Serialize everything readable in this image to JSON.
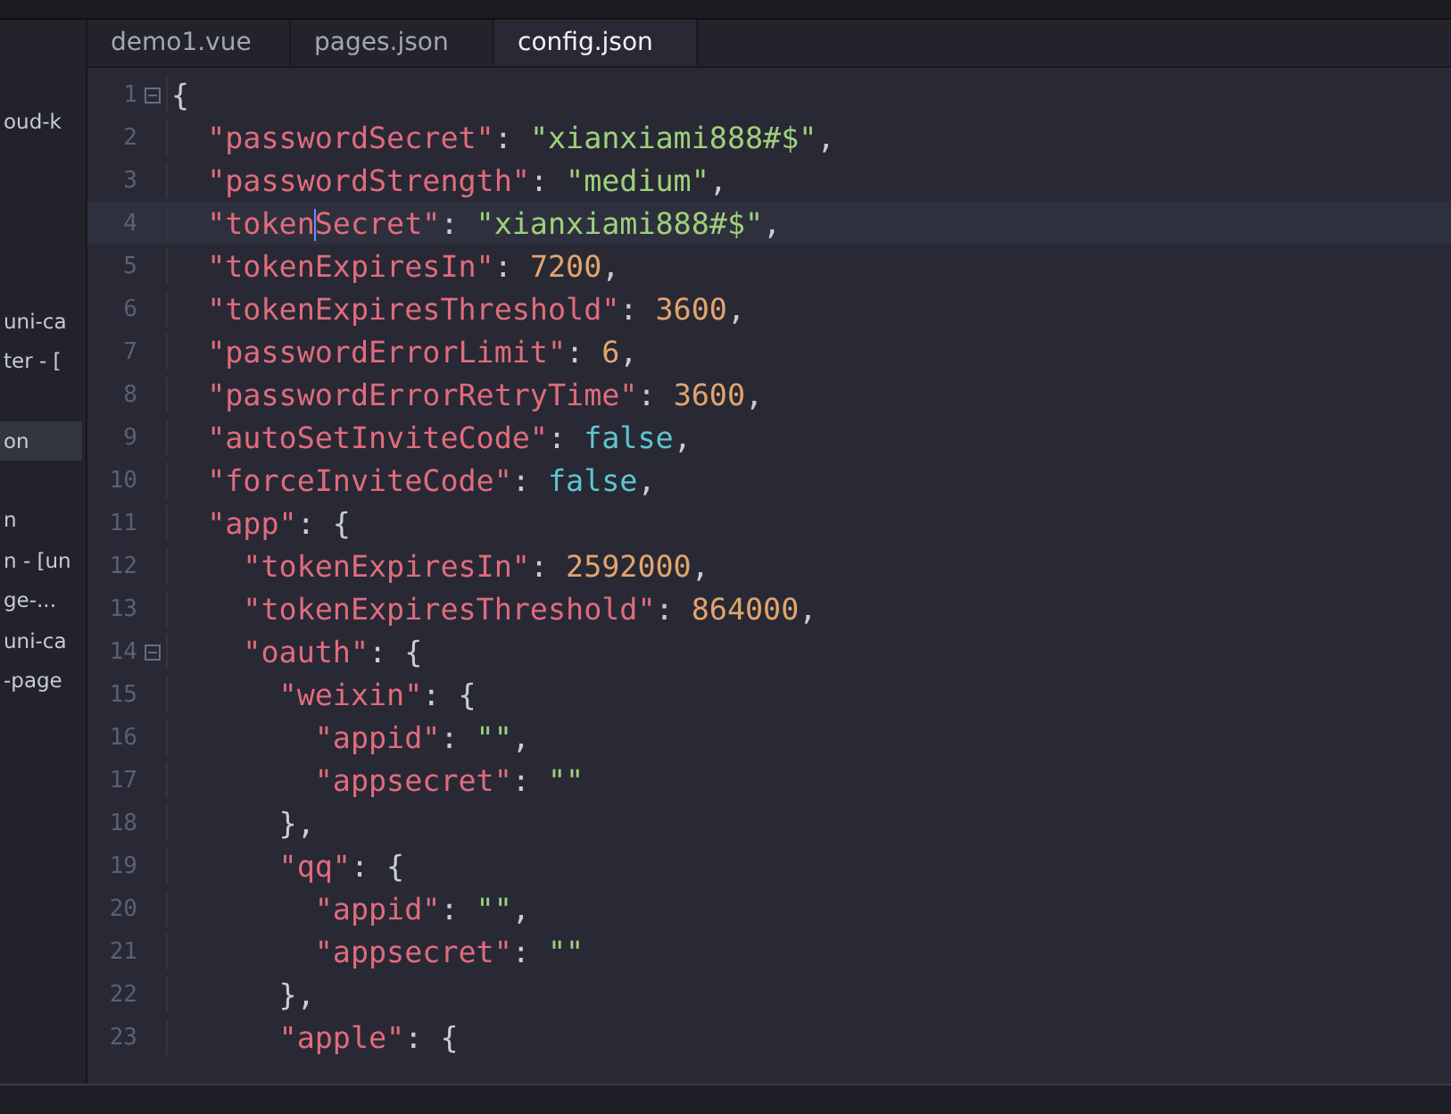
{
  "sidebar": {
    "groups": [
      [
        "oud-k"
      ],
      [
        "uni-ca",
        "ter - ["
      ],
      [
        {
          "label": "on",
          "selected": true
        }
      ],
      [
        "n",
        "n - [un",
        "ge-...",
        "uni-ca",
        "-page"
      ]
    ]
  },
  "tabs": [
    {
      "label": "demo1.vue",
      "selected": false
    },
    {
      "label": "pages.json",
      "selected": false
    },
    {
      "label": "config.json",
      "selected": true
    }
  ],
  "editor": {
    "lines": [
      {
        "number": "1",
        "foldable": true,
        "current": false,
        "tokens": [
          {
            "kind": "punct",
            "text": "{"
          }
        ]
      },
      {
        "number": "2",
        "foldable": false,
        "current": false,
        "tokens": [
          {
            "kind": "key",
            "text": "  \"passwordSecret\""
          },
          {
            "kind": "punct",
            "text": ": "
          },
          {
            "kind": "str",
            "text": "\"xianxiami888#$\""
          },
          {
            "kind": "punct",
            "text": ","
          }
        ]
      },
      {
        "number": "3",
        "foldable": false,
        "current": false,
        "tokens": [
          {
            "kind": "key",
            "text": "  \"passwordStrength\""
          },
          {
            "kind": "punct",
            "text": ": "
          },
          {
            "kind": "str",
            "text": "\"medium\""
          },
          {
            "kind": "punct",
            "text": ","
          }
        ]
      },
      {
        "number": "4",
        "foldable": false,
        "current": true,
        "tokens": [
          {
            "kind": "key",
            "text": "  \"token",
            "cursor": true
          },
          {
            "kind": "key",
            "text": "Secret\""
          },
          {
            "kind": "punct",
            "text": ": "
          },
          {
            "kind": "str",
            "text": "\"xianxiami888#$\""
          },
          {
            "kind": "punct",
            "text": ","
          }
        ]
      },
      {
        "number": "5",
        "foldable": false,
        "current": false,
        "tokens": [
          {
            "kind": "key",
            "text": "  \"tokenExpiresIn\""
          },
          {
            "kind": "punct",
            "text": ": "
          },
          {
            "kind": "num",
            "text": "7200"
          },
          {
            "kind": "punct",
            "text": ","
          }
        ]
      },
      {
        "number": "6",
        "foldable": false,
        "current": false,
        "tokens": [
          {
            "kind": "key",
            "text": "  \"tokenExpiresThreshold\""
          },
          {
            "kind": "punct",
            "text": ": "
          },
          {
            "kind": "num",
            "text": "3600"
          },
          {
            "kind": "punct",
            "text": ","
          }
        ]
      },
      {
        "number": "7",
        "foldable": false,
        "current": false,
        "tokens": [
          {
            "kind": "key",
            "text": "  \"passwordErrorLimit\""
          },
          {
            "kind": "punct",
            "text": ": "
          },
          {
            "kind": "num",
            "text": "6"
          },
          {
            "kind": "punct",
            "text": ","
          }
        ]
      },
      {
        "number": "8",
        "foldable": false,
        "current": false,
        "tokens": [
          {
            "kind": "key",
            "text": "  \"passwordErrorRetryTime\""
          },
          {
            "kind": "punct",
            "text": ": "
          },
          {
            "kind": "num",
            "text": "3600"
          },
          {
            "kind": "punct",
            "text": ","
          }
        ]
      },
      {
        "number": "9",
        "foldable": false,
        "current": false,
        "tokens": [
          {
            "kind": "key",
            "text": "  \"autoSetInviteCode\""
          },
          {
            "kind": "punct",
            "text": ": "
          },
          {
            "kind": "bool",
            "text": "false"
          },
          {
            "kind": "punct",
            "text": ","
          }
        ]
      },
      {
        "number": "10",
        "foldable": false,
        "current": false,
        "tokens": [
          {
            "kind": "key",
            "text": "  \"forceInviteCode\""
          },
          {
            "kind": "punct",
            "text": ": "
          },
          {
            "kind": "bool",
            "text": "false"
          },
          {
            "kind": "punct",
            "text": ","
          }
        ]
      },
      {
        "number": "11",
        "foldable": false,
        "current": false,
        "tokens": [
          {
            "kind": "key",
            "text": "  \"app\""
          },
          {
            "kind": "punct",
            "text": ": {"
          }
        ]
      },
      {
        "number": "12",
        "foldable": false,
        "current": false,
        "tokens": [
          {
            "kind": "key",
            "text": "    \"tokenExpiresIn\""
          },
          {
            "kind": "punct",
            "text": ": "
          },
          {
            "kind": "num",
            "text": "2592000"
          },
          {
            "kind": "punct",
            "text": ","
          }
        ]
      },
      {
        "number": "13",
        "foldable": false,
        "current": false,
        "tokens": [
          {
            "kind": "key",
            "text": "    \"tokenExpiresThreshold\""
          },
          {
            "kind": "punct",
            "text": ": "
          },
          {
            "kind": "num",
            "text": "864000"
          },
          {
            "kind": "punct",
            "text": ","
          }
        ]
      },
      {
        "number": "14",
        "foldable": true,
        "current": false,
        "tokens": [
          {
            "kind": "key",
            "text": "    \"oauth\""
          },
          {
            "kind": "punct",
            "text": ": {"
          }
        ]
      },
      {
        "number": "15",
        "foldable": false,
        "current": false,
        "tokens": [
          {
            "kind": "key",
            "text": "      \"weixin\""
          },
          {
            "kind": "punct",
            "text": ": {"
          }
        ]
      },
      {
        "number": "16",
        "foldable": false,
        "current": false,
        "tokens": [
          {
            "kind": "key",
            "text": "        \"appid\""
          },
          {
            "kind": "punct",
            "text": ": "
          },
          {
            "kind": "str",
            "text": "\"\""
          },
          {
            "kind": "punct",
            "text": ","
          }
        ]
      },
      {
        "number": "17",
        "foldable": false,
        "current": false,
        "tokens": [
          {
            "kind": "key",
            "text": "        \"appsecret\""
          },
          {
            "kind": "punct",
            "text": ": "
          },
          {
            "kind": "str",
            "text": "\"\""
          }
        ]
      },
      {
        "number": "18",
        "foldable": false,
        "current": false,
        "tokens": [
          {
            "kind": "punct",
            "text": "      },"
          }
        ]
      },
      {
        "number": "19",
        "foldable": false,
        "current": false,
        "tokens": [
          {
            "kind": "key",
            "text": "      \"qq\""
          },
          {
            "kind": "punct",
            "text": ": {"
          }
        ]
      },
      {
        "number": "20",
        "foldable": false,
        "current": false,
        "tokens": [
          {
            "kind": "key",
            "text": "        \"appid\""
          },
          {
            "kind": "punct",
            "text": ": "
          },
          {
            "kind": "str",
            "text": "\"\""
          },
          {
            "kind": "punct",
            "text": ","
          }
        ]
      },
      {
        "number": "21",
        "foldable": false,
        "current": false,
        "tokens": [
          {
            "kind": "key",
            "text": "        \"appsecret\""
          },
          {
            "kind": "punct",
            "text": ": "
          },
          {
            "kind": "str",
            "text": "\"\""
          }
        ]
      },
      {
        "number": "22",
        "foldable": false,
        "current": false,
        "tokens": [
          {
            "kind": "punct",
            "text": "      },"
          }
        ]
      },
      {
        "number": "23",
        "foldable": false,
        "current": false,
        "tokens": [
          {
            "kind": "key",
            "text": "      \"apple\""
          },
          {
            "kind": "punct",
            "text": ": {"
          }
        ]
      }
    ]
  }
}
